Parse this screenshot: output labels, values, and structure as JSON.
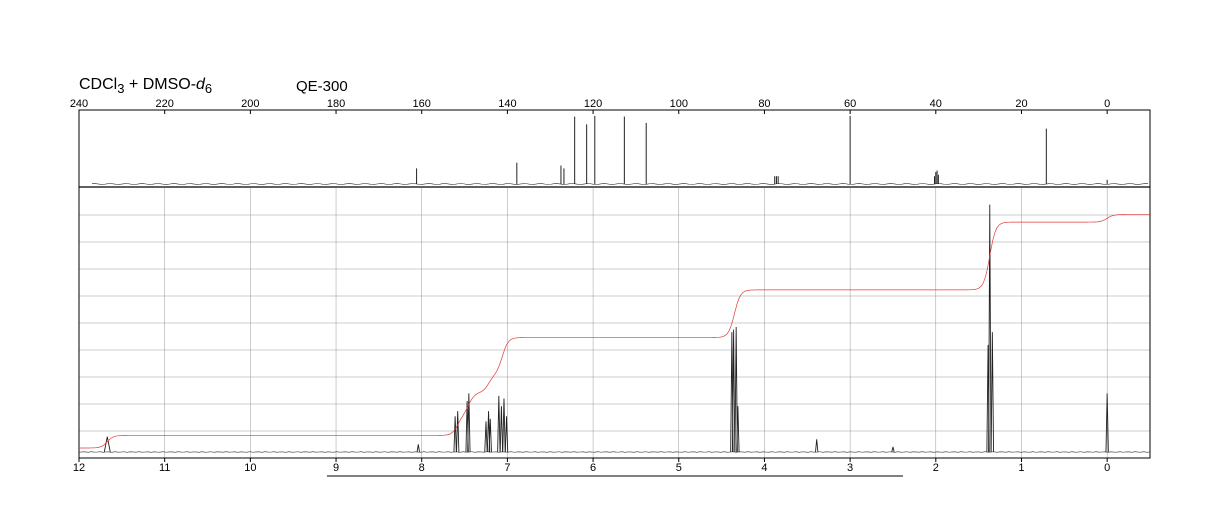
{
  "header": {
    "solvent": {
      "a": "CDCl",
      "a_sub": "3",
      "b": " + DMSO-",
      "c": "d",
      "c_sub": "6"
    },
    "instrument": "QE-300"
  },
  "chart_data": [
    {
      "type": "line",
      "nucleus": "13C",
      "x_ticks": [
        240,
        220,
        200,
        180,
        160,
        140,
        120,
        100,
        80,
        60,
        40,
        20,
        0
      ],
      "xlim": [
        240,
        -10
      ],
      "axis_direction": "descending",
      "peaks": [
        {
          "ppm": 161.2,
          "height": 0.22
        },
        {
          "ppm": 137.8,
          "height": 0.3
        },
        {
          "ppm": 127.5,
          "height": 0.26
        },
        {
          "ppm": 126.8,
          "height": 0.22
        },
        {
          "ppm": 124.3,
          "height": 0.95
        },
        {
          "ppm": 121.5,
          "height": 0.84
        },
        {
          "ppm": 119.6,
          "height": 0.96
        },
        {
          "ppm": 112.7,
          "height": 0.95
        },
        {
          "ppm": 107.6,
          "height": 0.86
        },
        {
          "ppm": 77.6,
          "height": 0.11
        },
        {
          "ppm": 77.2,
          "height": 0.11
        },
        {
          "ppm": 76.8,
          "height": 0.11
        },
        {
          "ppm": 60.0,
          "height": 0.96
        },
        {
          "ppm": 40.3,
          "height": 0.11
        },
        {
          "ppm": 40.0,
          "height": 0.17
        },
        {
          "ppm": 39.7,
          "height": 0.19
        },
        {
          "ppm": 39.4,
          "height": 0.13
        },
        {
          "ppm": 14.2,
          "height": 0.78
        },
        {
          "ppm": 0.0,
          "height": 0.06
        }
      ]
    },
    {
      "type": "line",
      "nucleus": "1H",
      "x_ticks": [
        12,
        11,
        10,
        9,
        8,
        7,
        6,
        5,
        4,
        3,
        2,
        1,
        0
      ],
      "xlim": [
        12,
        -0.5
      ],
      "axis_direction": "descending",
      "grid": true,
      "peaks": [
        {
          "ppm": 11.67,
          "height": 0.06
        },
        {
          "ppm": 8.04,
          "height": 0.03
        },
        {
          "ppm": 7.61,
          "height": 0.14
        },
        {
          "ppm": 7.58,
          "height": 0.16
        },
        {
          "ppm": 7.47,
          "height": 0.2
        },
        {
          "ppm": 7.45,
          "height": 0.23
        },
        {
          "ppm": 7.25,
          "height": 0.12
        },
        {
          "ppm": 7.22,
          "height": 0.16
        },
        {
          "ppm": 7.2,
          "height": 0.13
        },
        {
          "ppm": 7.1,
          "height": 0.22
        },
        {
          "ppm": 7.07,
          "height": 0.18
        },
        {
          "ppm": 7.04,
          "height": 0.21
        },
        {
          "ppm": 7.01,
          "height": 0.14
        },
        {
          "ppm": 4.38,
          "height": 0.47
        },
        {
          "ppm": 4.36,
          "height": 0.48
        },
        {
          "ppm": 4.33,
          "height": 0.49
        },
        {
          "ppm": 4.31,
          "height": 0.18
        },
        {
          "ppm": 3.39,
          "height": 0.05
        },
        {
          "ppm": 2.5,
          "height": 0.02
        },
        {
          "ppm": 1.39,
          "height": 0.42
        },
        {
          "ppm": 1.37,
          "height": 0.97
        },
        {
          "ppm": 1.34,
          "height": 0.47
        },
        {
          "ppm": 0.0,
          "height": 0.23
        }
      ],
      "integral_steps": [
        {
          "ppm": 11.67,
          "rise": 0.05
        },
        {
          "ppm": 7.58,
          "rise": 0.08
        },
        {
          "ppm": 7.45,
          "rise": 0.09
        },
        {
          "ppm": 7.22,
          "rise": 0.07
        },
        {
          "ppm": 7.06,
          "rise": 0.15
        },
        {
          "ppm": 4.35,
          "rise": 0.19
        },
        {
          "ppm": 1.37,
          "rise": 0.27
        },
        {
          "ppm": 0.0,
          "rise": 0.03
        }
      ]
    }
  ]
}
